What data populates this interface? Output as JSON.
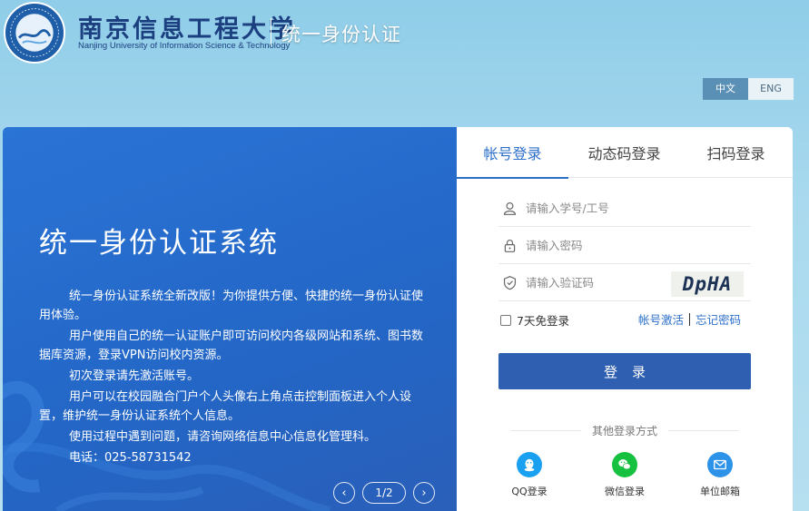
{
  "header": {
    "school_name": "南京信息工程大学",
    "school_name_en": "Nanjing University of Information Science & Technology",
    "system_title": "统一身份认证"
  },
  "language": {
    "zh": "中文",
    "en": "ENG",
    "active": "zh"
  },
  "banner": {
    "title": "统一身份认证系统",
    "paragraphs": [
      "统一身份认证系统全新改版！为你提供方便、快捷的统一身份认证使用体验。",
      "用户使用自己的统一认证账户即可访问校内各级网站和系统、图书数据库资源，登录VPN访问校内资源。",
      "初次登录请先激活账号。",
      "用户可以在校园融合门户个人头像右上角点击控制面板进入个人设置，维护统一身份认证系统个人信息。",
      "使用过程中遇到问题，请咨询网络信息中心信息化管理科。",
      "电话：025-58731542"
    ],
    "pager": {
      "prev_icon": "‹",
      "next_icon": "›",
      "current": "1/2"
    }
  },
  "login": {
    "tabs": [
      {
        "label": "帐号登录",
        "active": true
      },
      {
        "label": "动态码登录",
        "active": false
      },
      {
        "label": "扫码登录",
        "active": false
      }
    ],
    "username": {
      "placeholder": "请输入学号/工号",
      "value": "",
      "icon": "user-icon"
    },
    "password": {
      "placeholder": "请输入密码",
      "value": "",
      "icon": "lock-icon"
    },
    "captcha": {
      "placeholder": "请输入验证码",
      "value": "",
      "icon": "shield-icon",
      "image_text": "DpHA"
    },
    "remember_label": "7天免登录",
    "remember_checked": false,
    "activate_link": "帐号激活",
    "forgot_link": "忘记密码",
    "submit_label": "登录",
    "other_methods_label": "其他登录方式",
    "other_methods": [
      {
        "label": "QQ登录",
        "icon": "qq-icon",
        "color": "#1aa0f0"
      },
      {
        "label": "微信登录",
        "icon": "wechat-icon",
        "color": "#15c13e"
      },
      {
        "label": "单位邮箱",
        "icon": "mail-icon",
        "color": "#2c93e8"
      }
    ]
  },
  "colors": {
    "page_bg": "#a9d9ee",
    "banner_bg": "#2a6fd0",
    "accent": "#2c6fc9",
    "login_button": "#2f5fb0",
    "lang_active": "#5a8fb6"
  }
}
